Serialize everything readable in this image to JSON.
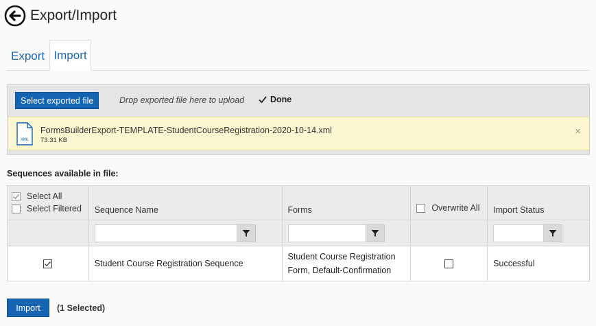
{
  "header": {
    "title": "Export/Import",
    "back_icon": "back-arrow-icon"
  },
  "tabs": [
    {
      "label": "Export",
      "active": false
    },
    {
      "label": "Import",
      "active": true
    }
  ],
  "upload": {
    "select_button": "Select exported file",
    "drop_hint": "Drop exported file here to upload",
    "status": "Done",
    "file": {
      "icon_label": "XML",
      "name": "FormsBuilderExport-TEMPLATE-StudentCourseRegistration-2020-10-14.xml",
      "size": "73.31 KB",
      "remove_glyph": "×"
    }
  },
  "section_heading": "Sequences available in file:",
  "table": {
    "select_all_label": "Select All",
    "select_filtered_label": "Select Filtered",
    "columns": {
      "sequence_name": "Sequence Name",
      "forms": "Forms",
      "overwrite_all": "Overwrite All",
      "import_status": "Import Status"
    },
    "filters": {
      "sequence_name": "",
      "forms": "",
      "import_status": ""
    },
    "rows": [
      {
        "selected": true,
        "sequence_name": "Student Course Registration Sequence",
        "forms": "Student Course Registration Form, Default-Confirmation",
        "overwrite": false,
        "import_status": "Successful"
      }
    ]
  },
  "footer": {
    "import_button": "Import",
    "selected_count": "(1 Selected)"
  },
  "colors": {
    "primary": "#1565b2",
    "link": "#1f66b1",
    "file_row_bg": "#fbf6cf",
    "panel_bg": "#e5e5e5"
  }
}
